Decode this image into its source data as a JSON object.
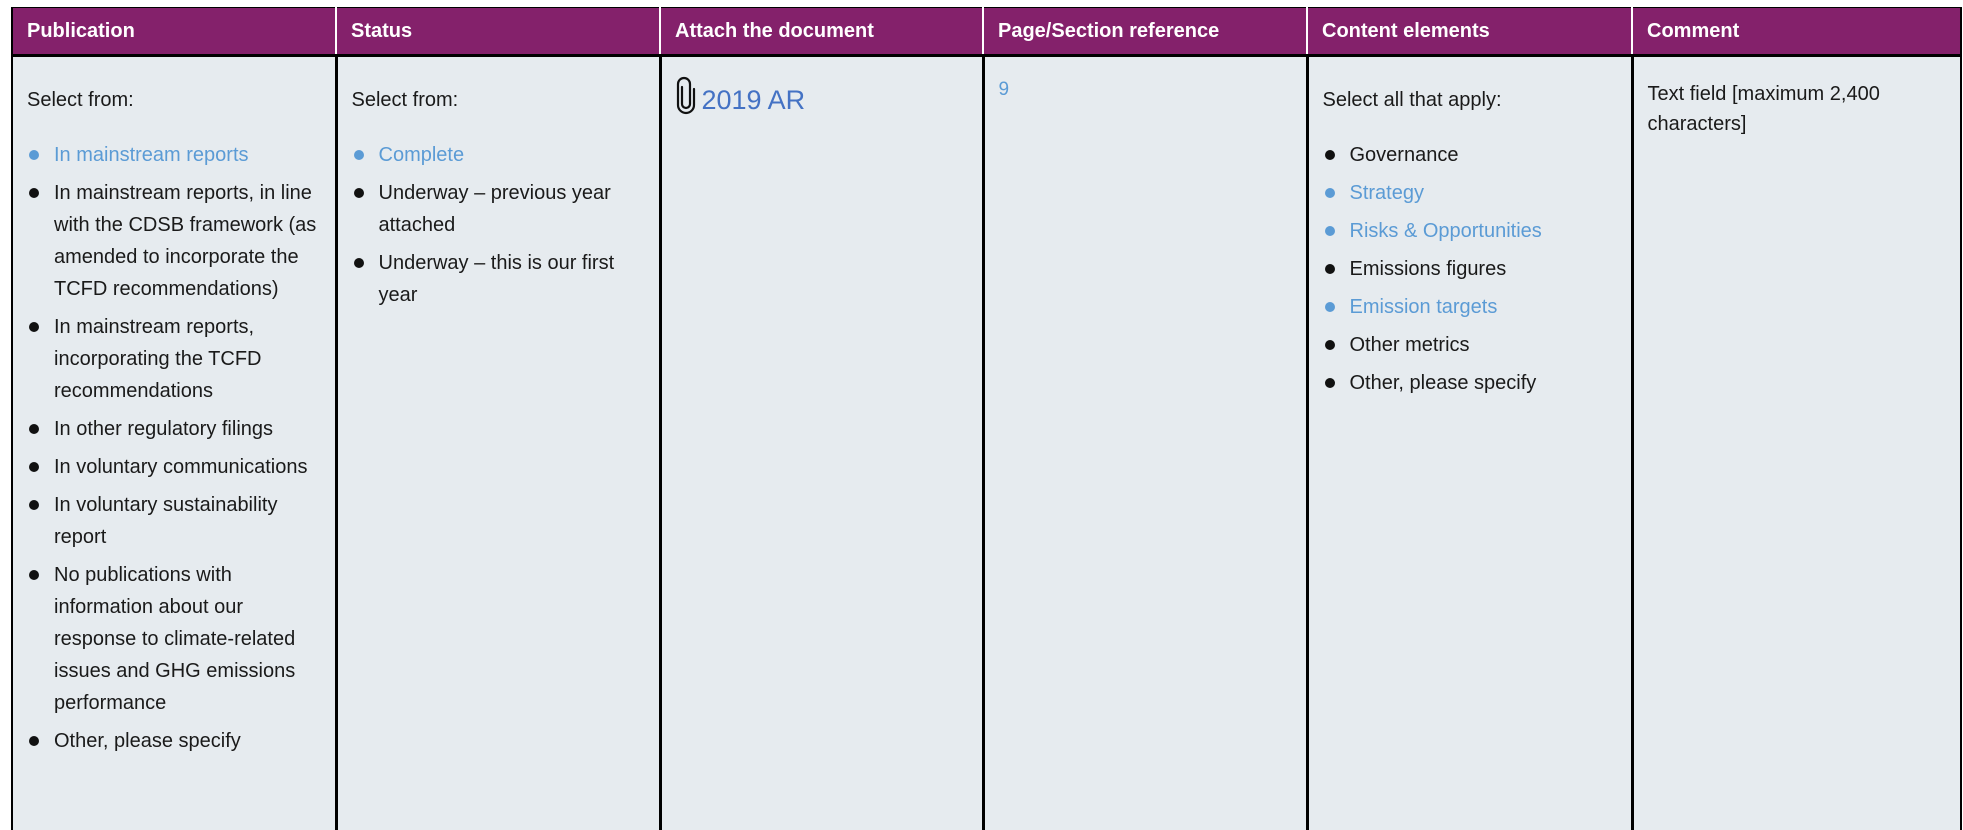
{
  "headers": [
    "Publication",
    "Status",
    "Attach the document",
    "Page/Section reference",
    "Content elements",
    "Comment"
  ],
  "publication": {
    "intro": "Select from:",
    "options": [
      {
        "label": "In mainstream reports",
        "selected": true
      },
      {
        "label": "In mainstream reports, in line with the CDSB framework (as amended to incorporate the TCFD recommendations)",
        "selected": false
      },
      {
        "label": "In mainstream reports, incorporating the TCFD recommendations",
        "selected": false
      },
      {
        "label": "In other regulatory filings",
        "selected": false
      },
      {
        "label": "In voluntary communications",
        "selected": false
      },
      {
        "label": "In voluntary sustainability report",
        "selected": false
      },
      {
        "label": "No publications with information about our response to climate-related issues and GHG emissions performance",
        "selected": false
      },
      {
        "label": "Other, please specify",
        "selected": false
      }
    ]
  },
  "status": {
    "intro": "Select from:",
    "options": [
      {
        "label": "Complete",
        "selected": true
      },
      {
        "label": "Underway – previous year attached",
        "selected": false
      },
      {
        "label": "Underway – this is our first year",
        "selected": false
      }
    ]
  },
  "attachment": {
    "icon": "paperclip-icon",
    "label": "2019 AR"
  },
  "page_reference": "9",
  "content_elements": {
    "intro": "Select all that apply:",
    "options": [
      {
        "label": "Governance",
        "selected": false
      },
      {
        "label": "Strategy",
        "selected": true
      },
      {
        "label": "Risks & Opportunities",
        "selected": true
      },
      {
        "label": "Emissions figures",
        "selected": false
      },
      {
        "label": "Emission targets",
        "selected": true
      },
      {
        "label": "Other metrics",
        "selected": false
      },
      {
        "label": "Other, please specify",
        "selected": false
      }
    ]
  },
  "comment": "Text field [maximum 2,400 characters]",
  "colors": {
    "header_bg": "#84216b",
    "cell_bg": "#e6ebef",
    "selected": "#5b9bd5",
    "link": "#4472c4"
  }
}
